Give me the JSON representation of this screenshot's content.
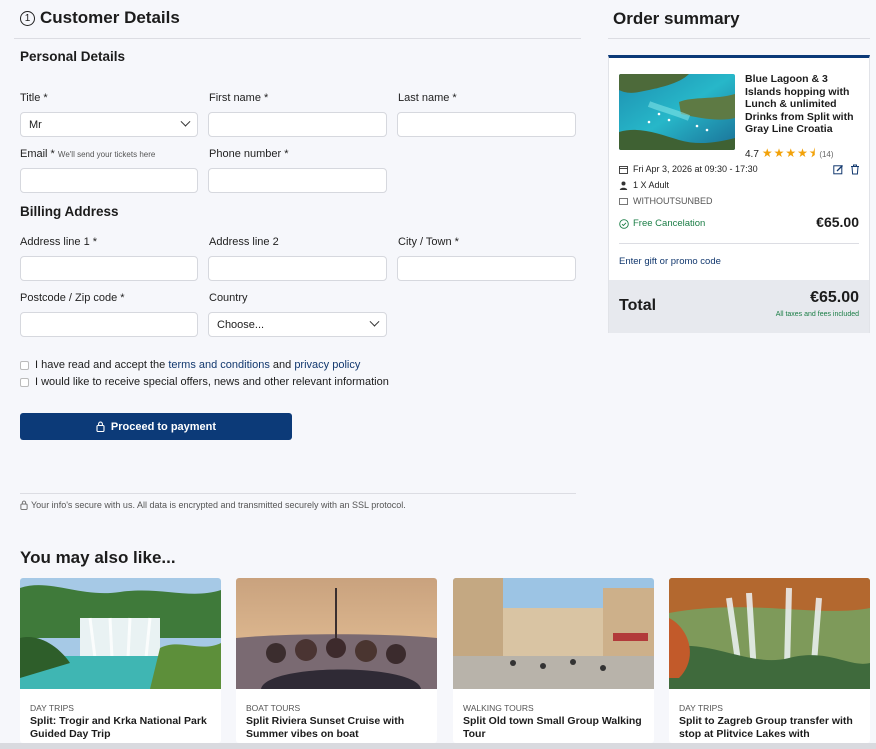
{
  "customer": {
    "step_number": "1",
    "title": "Customer Details",
    "personal_section": "Personal Details",
    "billing_section": "Billing Address",
    "fields": {
      "title_label": "Title *",
      "title_value": "Mr",
      "first_name_label": "First name *",
      "first_name_value": "",
      "last_name_label": "Last name *",
      "last_name_value": "",
      "email_label": "Email *",
      "email_hint": "We'll send your tickets here",
      "email_value": "",
      "phone_label": "Phone number *",
      "phone_value": "",
      "address1_label": "Address line 1 *",
      "address1_value": "",
      "address2_label": "Address line 2",
      "address2_value": "",
      "city_label": "City / Town *",
      "city_value": "",
      "postcode_label": "Postcode / Zip code *",
      "postcode_value": "",
      "country_label": "Country",
      "country_value": "Choose..."
    },
    "terms": {
      "prefix": "I have read and accept the",
      "terms_link": "terms and conditions",
      "and": "and",
      "privacy_link": "privacy policy",
      "checked": false
    },
    "offers": {
      "label": "I would like to receive special offers, news and other relevant information",
      "checked": false
    },
    "pay_button": "Proceed to payment",
    "secure_note": "Your info's secure with us. All data is encrypted and transmitted securely with an SSL protocol."
  },
  "order": {
    "title": "Order summary",
    "tour_title": "Blue Lagoon & 3 Islands hopping with Lunch & unlimited Drinks from Split with Gray Line Croatia",
    "rating": "4.7",
    "stars": "★★★★⯨",
    "reviews": "(14)",
    "date": "Fri Apr 3, 2026 at 09:30 - 17:30",
    "guests": "1 X Adult",
    "code": "WITHOUTSUNBED",
    "free_cancel": "Free Cancelation",
    "item_price": "€65.00",
    "promo": "Enter gift or promo code",
    "total_label": "Total",
    "total_price": "€65.00",
    "total_note": "All taxes and fees included",
    "accent_color": "#0c3a78",
    "success_color": "#1a7d45"
  },
  "recommendations": {
    "title": "You may also like...",
    "items": [
      {
        "category": "DAY TRIPS",
        "title": "Split: Trogir and Krka National Park Guided Day Trip"
      },
      {
        "category": "BOAT TOURS",
        "title": "Split Riviera Sunset Cruise with Summer vibes on boat"
      },
      {
        "category": "WALKING TOURS",
        "title": "Split Old town Small Group Walking Tour"
      },
      {
        "category": "DAY TRIPS",
        "title": "Split to Zagreb Group transfer with stop at Plitvice Lakes with"
      }
    ]
  }
}
